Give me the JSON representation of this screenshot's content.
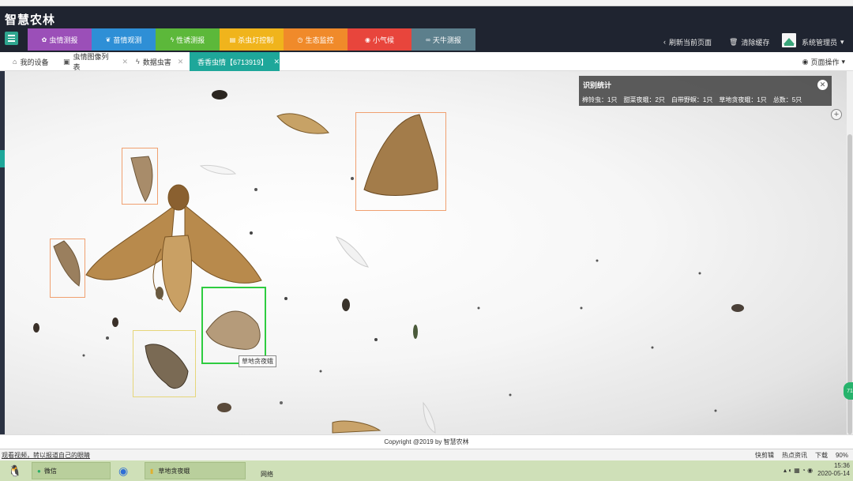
{
  "app": {
    "title": "智慧农林"
  },
  "nav": {
    "tabs": [
      {
        "label": "虫情测报",
        "icon": "bug-icon",
        "color": "#9b4fb8"
      },
      {
        "label": "苗情观测",
        "icon": "leaf-icon",
        "color": "#2e8fd6"
      },
      {
        "label": "性诱测报",
        "icon": "bolt-icon",
        "color": "#5cb83a"
      },
      {
        "label": "杀虫灯控制",
        "icon": "lamp-icon",
        "color": "#f0b41c"
      },
      {
        "label": "生态监控",
        "icon": "camera-icon",
        "color": "#f08a2a"
      },
      {
        "label": "小气候",
        "icon": "weather-icon",
        "color": "#e8453c"
      },
      {
        "label": "天牛测报",
        "icon": "beetle-icon",
        "color": "#5c7f8c"
      }
    ]
  },
  "header": {
    "refresh_label": "刷新当前页面",
    "clear_cache_label": "清除缓存",
    "user_label": "系统管理员"
  },
  "tabbar": {
    "tabs": [
      {
        "label": "我的设备",
        "icon": "home-icon",
        "closable": false
      },
      {
        "label": "虫情图像列表",
        "icon": "image-icon",
        "closable": true
      },
      {
        "label": "数据虫害",
        "icon": "bolt-icon",
        "closable": true
      },
      {
        "label": "香香虫情【6713919】",
        "icon": "",
        "closable": true,
        "active": true
      }
    ],
    "page_ops_label": "页面操作"
  },
  "stats": {
    "title": "识别统计",
    "items": [
      "棉铃虫：1只",
      "甜菜夜蛾：2只",
      "白带野螟：1只",
      "草地贪夜蛾：1只",
      "总数：5只"
    ]
  },
  "detections": [
    {
      "label": "草地贪夜蛾",
      "color": "#22c55e"
    }
  ],
  "detection_colors": {
    "orange": "#f0a070",
    "yellow": "#e6d67a",
    "green": "#2ecc40"
  },
  "footer": {
    "copyright": "Copyright @2019 by 智慧农林"
  },
  "statusbar": {
    "left": "观看视频，转以报道自己的眼睛",
    "right": [
      "快剪辑",
      "热点资讯",
      "下载",
      "90%"
    ]
  },
  "taskbar": {
    "items": [
      "微信",
      "草地贪夜蛾",
      "网络"
    ],
    "time": "15:36",
    "date": "2020-05-14"
  }
}
